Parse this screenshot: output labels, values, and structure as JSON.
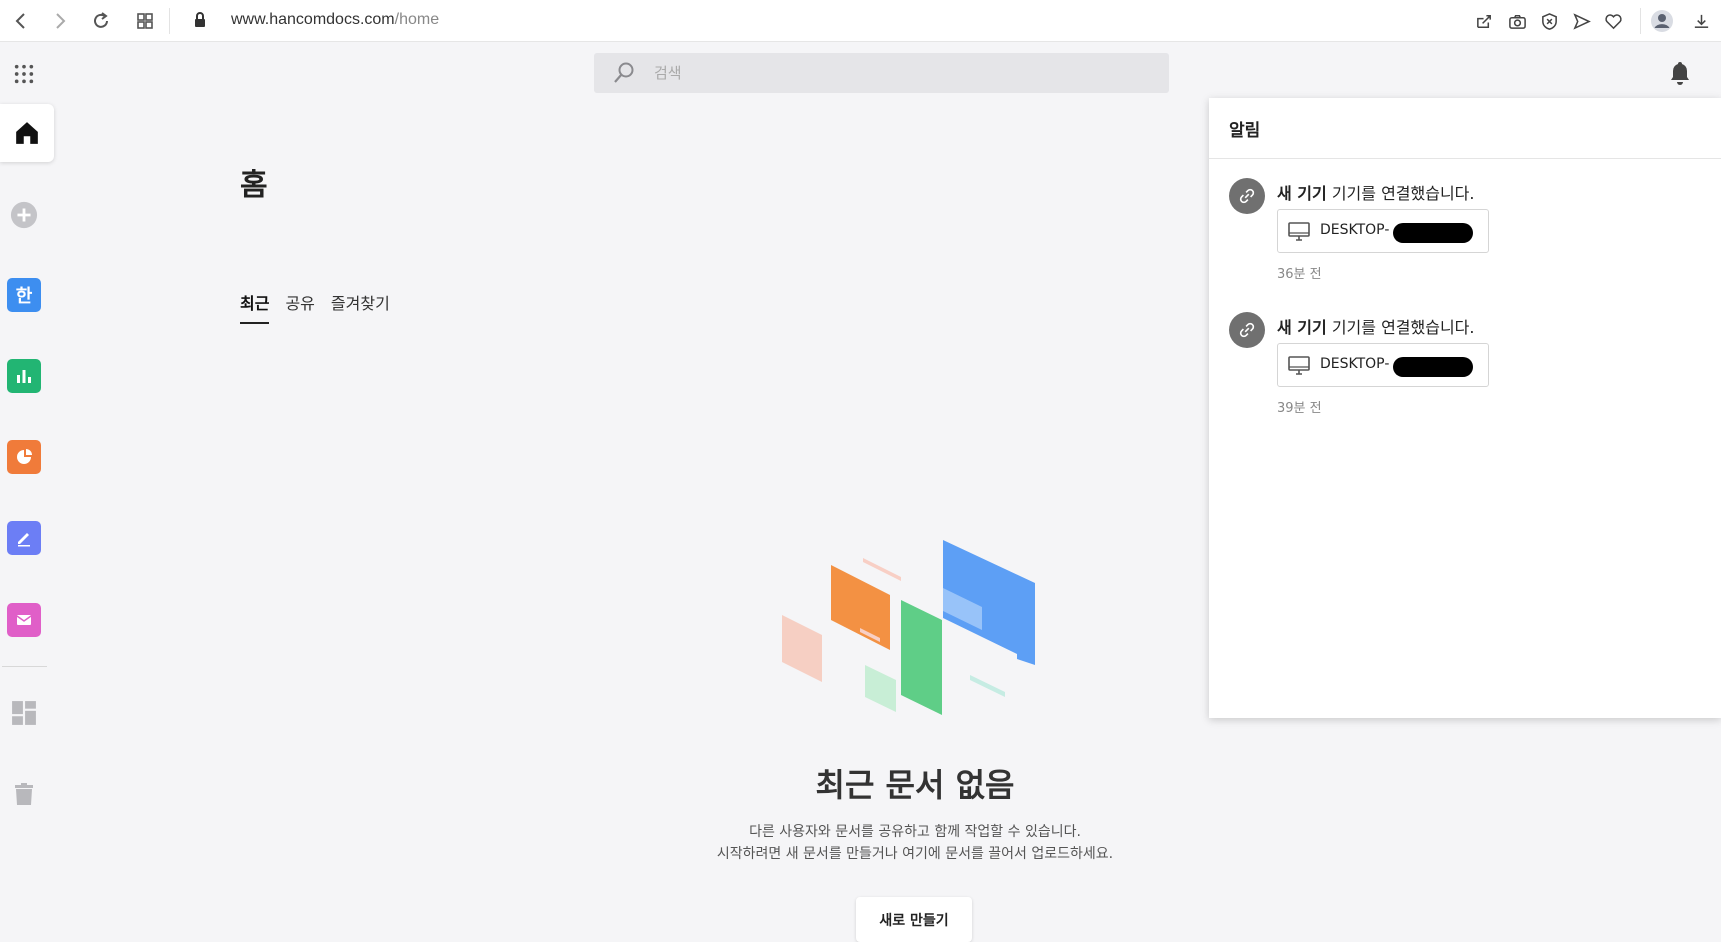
{
  "browser": {
    "url_host": "www.hancomdocs.com",
    "url_path": "/home"
  },
  "search": {
    "placeholder": "검색"
  },
  "main": {
    "title": "홈",
    "tabs": [
      {
        "label": "최근",
        "active": true
      },
      {
        "label": "공유",
        "active": false
      },
      {
        "label": "즐겨찾기",
        "active": false
      }
    ],
    "empty_title": "최근 문서 없음",
    "empty_desc_line1": "다른 사용자와 문서를 공유하고 함께 작업할 수 있습니다.",
    "empty_desc_line2": "시작하려면 새 문서를 만들거나 여기에 문서를 끌어서 업로드하세요.",
    "new_button": "새로 만들기"
  },
  "sidebar": {
    "items": [
      {
        "name": "home",
        "icon": "home-icon"
      },
      {
        "name": "add",
        "icon": "plus-circle-icon"
      },
      {
        "name": "hanword",
        "icon": "hanword-app-icon",
        "color": "#3d8ef0"
      },
      {
        "name": "hancell",
        "icon": "hancell-app-icon",
        "color": "#22b573"
      },
      {
        "name": "hanshow",
        "icon": "hanshow-app-icon",
        "color": "#f07b3a"
      },
      {
        "name": "pdf",
        "icon": "pdf-edit-app-icon",
        "color": "#6c7ef5"
      },
      {
        "name": "mail",
        "icon": "mail-app-icon",
        "color": "#e05fc8"
      },
      {
        "name": "dashboard",
        "icon": "dashboard-icon"
      },
      {
        "name": "trash",
        "icon": "trash-icon"
      }
    ]
  },
  "notifications": {
    "title": "알림",
    "items": [
      {
        "bold": "새 기기",
        "text": " 기기를 연결했습니다.",
        "device": "DESKTOP-",
        "time": "36분 전"
      },
      {
        "bold": "새 기기",
        "text": " 기기를 연결했습니다.",
        "device": "DESKTOP-",
        "time": "39분 전"
      }
    ]
  }
}
